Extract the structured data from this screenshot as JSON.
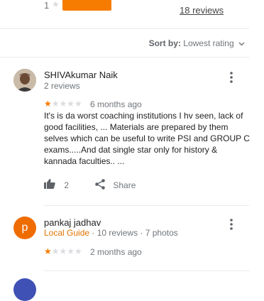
{
  "histogram": {
    "row_label": "1",
    "row_star": "★",
    "reviews_link": "18 reviews",
    "row_fraction": 0.45
  },
  "sort": {
    "label": "Sort by:",
    "value": "Lowest rating"
  },
  "reviews": [
    {
      "name": "SHIVAkumar Naik",
      "meta": "2 reviews",
      "rating": 1,
      "stars_on": "★",
      "stars_off": "★★★★",
      "time": "6 months ago",
      "text": "It's is da worst coaching institutions I hv seen, lack of good facilities, ... Materials are prepared by them selves which can be useful to write PSI and GROUP C exams.....And dat single star only for history & kannada faculties.. ...",
      "likes": "2",
      "share_label": "Share"
    },
    {
      "name": "pankaj jadhav",
      "initial": "p",
      "guide": "Local Guide",
      "meta": " · 10 reviews · 7 photos",
      "rating": 1,
      "stars_on": "★",
      "stars_off": "★★★★",
      "time": "2 months ago"
    }
  ],
  "colors": {
    "accent": "#f57c00",
    "guide": "#e37400",
    "avatar_p": "#ef6c00"
  },
  "icons": {
    "like": "thumb-up-icon",
    "share": "share-icon",
    "more": "more-vert-icon",
    "sort": "chevron-down-icon"
  }
}
